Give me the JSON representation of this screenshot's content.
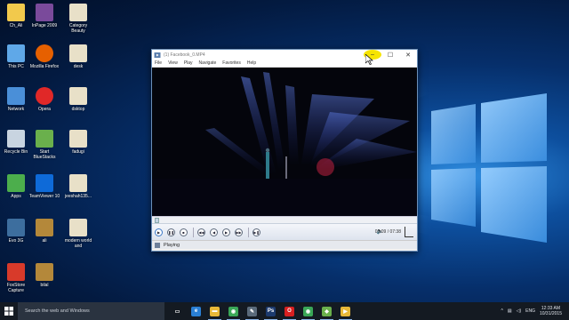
{
  "desktop": {
    "icons": [
      {
        "label": "Ch_Ali",
        "icon": "user-folder-icon",
        "color": "#f2c94c"
      },
      {
        "label": "InPage 2009",
        "icon": "inpage-icon",
        "color": "#7a4a9b"
      },
      {
        "label": "Category Beauty",
        "icon": "document-icon",
        "color": "#e8e0c8"
      },
      {
        "label": "This PC",
        "icon": "computer-icon",
        "color": "#5fa8e8"
      },
      {
        "label": "Mozilla Firefox",
        "icon": "firefox-icon",
        "color": "#e66000"
      },
      {
        "label": "desk",
        "icon": "document-icon",
        "color": "#e8e0c8"
      },
      {
        "label": "Network",
        "icon": "network-icon",
        "color": "#4a8fd8"
      },
      {
        "label": "Opera",
        "icon": "opera-icon",
        "color": "#e02828"
      },
      {
        "label": "dsktop",
        "icon": "document-icon",
        "color": "#e8e0c8"
      },
      {
        "label": "Recycle Bin",
        "icon": "recycle-bin-icon",
        "color": "#c8d4e0"
      },
      {
        "label": "Start BlueStacks",
        "icon": "bluestacks-icon",
        "color": "#6ab04c"
      },
      {
        "label": "fadugi",
        "icon": "document-icon",
        "color": "#e8e0c8"
      },
      {
        "label": "Apps",
        "icon": "apps-icon",
        "color": "#4cae4c"
      },
      {
        "label": "TeamViewer 10",
        "icon": "teamviewer-icon",
        "color": "#0e6ad8"
      },
      {
        "label": "jeeshah135...",
        "icon": "document-icon",
        "color": "#e8e0c8"
      },
      {
        "label": "Evo 3G",
        "icon": "evo-icon",
        "color": "#3d6e9e"
      },
      {
        "label": "ali",
        "icon": "image-file-icon",
        "color": "#b4883a"
      },
      {
        "label": "modern world and",
        "icon": "document-icon",
        "color": "#e8e0c8"
      },
      {
        "label": "FoxStore Capture",
        "icon": "foxstore-icon",
        "color": "#d83a2a"
      },
      {
        "label": "bilal",
        "icon": "image-file-icon",
        "color": "#b4883a"
      }
    ]
  },
  "player": {
    "title": "(1) Facebook_0.MP4",
    "menu": [
      "File",
      "View",
      "Play",
      "Navigate",
      "Favorites",
      "Help"
    ],
    "min_symbol": "–",
    "max_symbol": "☐",
    "close_symbol": "✕",
    "time": "00:09 / 07:38",
    "status": "Playing",
    "progress": 0.02
  },
  "taskbar": {
    "search_placeholder": "Search the web and Windows",
    "apps": [
      {
        "name": "task-view",
        "glyph": "▭",
        "color": "#141a22"
      },
      {
        "name": "edge",
        "glyph": "e",
        "color": "#2a7fd4"
      },
      {
        "name": "file-explorer",
        "glyph": "▬",
        "color": "#e8b838"
      },
      {
        "name": "chrome",
        "glyph": "◉",
        "color": "#3aa757"
      },
      {
        "name": "paint",
        "glyph": "✎",
        "color": "#5a6a7a"
      },
      {
        "name": "photoshop",
        "glyph": "Ps",
        "color": "#1c3a6e"
      },
      {
        "name": "opera",
        "glyph": "O",
        "color": "#d82020"
      },
      {
        "name": "chrome-2",
        "glyph": "◉",
        "color": "#3aa757"
      },
      {
        "name": "bluestacks",
        "glyph": "◆",
        "color": "#6ab04c"
      },
      {
        "name": "media-player",
        "glyph": "▶",
        "color": "#e8b838"
      }
    ],
    "lang": "ENG",
    "time": "12:33 AM",
    "date": "10/31/2015"
  },
  "colors": {
    "accent": "#0078d7",
    "taskbar": "#141a22"
  }
}
